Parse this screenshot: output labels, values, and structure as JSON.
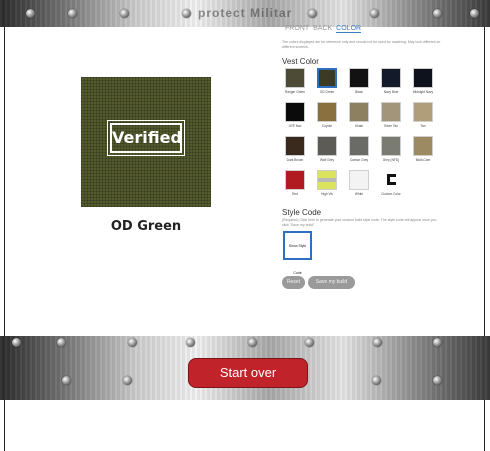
{
  "header": {
    "title": "protect Militar"
  },
  "preview": {
    "badge": "Verified",
    "color_name": "OD Green",
    "color_hex": "#545a2e"
  },
  "tabs": [
    {
      "label": "FRONT",
      "active": false
    },
    {
      "label": "BACK",
      "active": false
    },
    {
      "label": "COLOR",
      "active": true
    }
  ],
  "disclaimer": "The colors displayed are for reference only and should not be used for matching. May look different on different screens.",
  "vest_color": {
    "title": "Vest Color",
    "swatches": [
      {
        "label": "Ranger Green",
        "color": "#4d4a35"
      },
      {
        "label": "OD Green",
        "color": "#3b3a22",
        "selected": true
      },
      {
        "label": "Black",
        "color": "#121212"
      },
      {
        "label": "Navy Blue",
        "color": "#131a2a"
      },
      {
        "label": "Midnight Navy",
        "color": "#0e121c"
      },
      {
        "label": "LE® Nav",
        "color": "#0b0b0b"
      },
      {
        "label": "Coyote",
        "color": "#8a703f"
      },
      {
        "label": "Khaki",
        "color": "#8c8061"
      },
      {
        "label": "Silver Tan",
        "color": "#a39579"
      },
      {
        "label": "Tan",
        "color": "#b09d79"
      },
      {
        "label": "Dark Brown",
        "color": "#3a2a1d"
      },
      {
        "label": "Wolf Grey",
        "color": "#5c5b56"
      },
      {
        "label": "Carbon Grey",
        "color": "#6a6a66"
      },
      {
        "label": "Grey (NFD)",
        "color": "#7a7b72"
      },
      {
        "label": "Multi-Cam",
        "color": "#9c8b62"
      },
      {
        "label": "Red",
        "color": "#b11a20"
      },
      {
        "label": "High Vis",
        "color": "#d9e35c"
      },
      {
        "label": "White",
        "color": "#f3f3f3"
      },
      {
        "label": "Custom Color",
        "color": "#ffffff"
      }
    ]
  },
  "style_code": {
    "title": "Style Code",
    "description": "(Required) Click here to generate your custom build style code. The style code will appear once you click \"Save my build\".",
    "button_label": "Show Style Code"
  },
  "actions": {
    "reset_label": "Reset",
    "save_label": "Save my build"
  },
  "footer": {
    "start_over_label": "Start over"
  }
}
